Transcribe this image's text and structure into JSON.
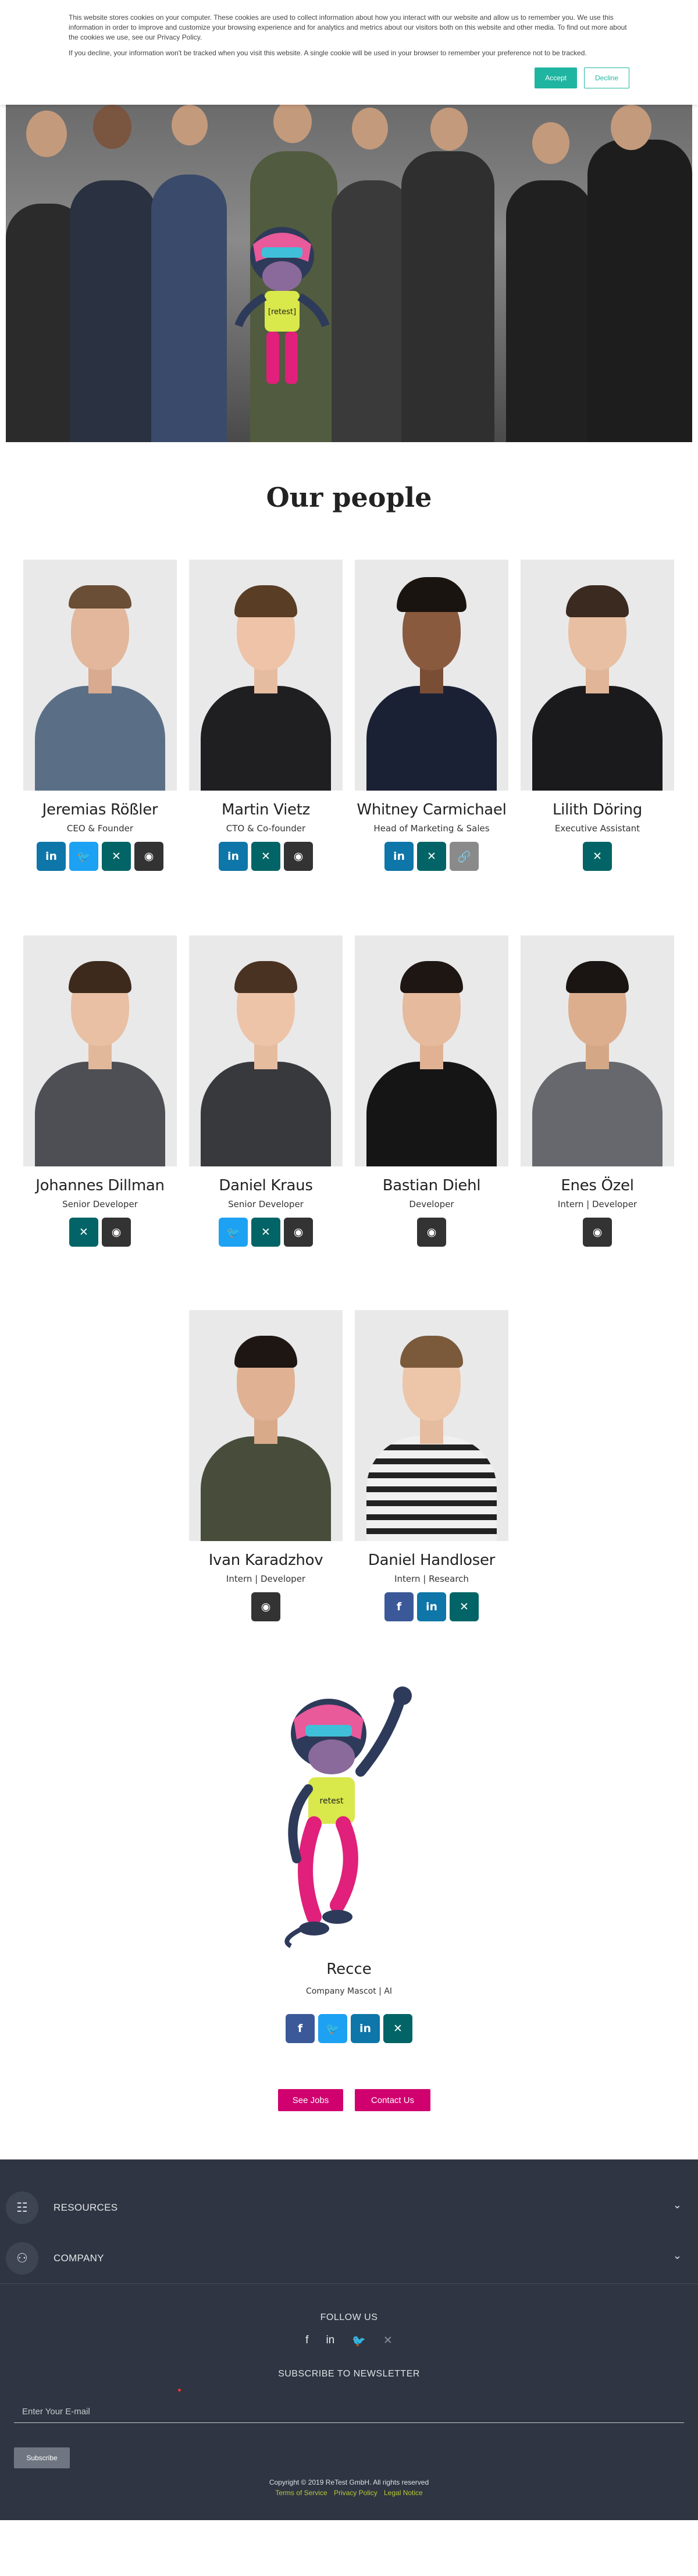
{
  "cookie": {
    "text1": "This website stores cookies on your computer. These cookies are used to collect information about how you interact with our website and allow us to remember you. We use this information in order to improve and customize your browsing experience and for analytics and metrics about our visitors both on this website and other media. To find out more about the cookies we use, see our Privacy Policy.",
    "text2": "If you decline, your information won't be tracked when you visit this website. A single cookie will be used in your browser to remember your preference not to be tracked.",
    "accept": "Accept",
    "decline": "Decline"
  },
  "hero": {
    "mascot_shirt": "[retest]"
  },
  "section_title": "Our people",
  "people": [
    {
      "name": "Jeremias Rößler",
      "role": "CEO & Founder"
    },
    {
      "name": "Martin Vietz",
      "role": "CTO & Co-founder"
    },
    {
      "name": "Whitney Carmichael",
      "role": "Head of Marketing & Sales"
    },
    {
      "name": "Lilith Döring",
      "role": "Executive Assistant"
    },
    {
      "name": "Johannes Dillman",
      "role": "Senior Developer"
    },
    {
      "name": "Daniel Kraus",
      "role": "Senior Developer"
    },
    {
      "name": "Bastian Diehl",
      "role": "Developer"
    },
    {
      "name": "Enes Özel",
      "role": "Intern | Developer"
    },
    {
      "name": "Ivan Karadzhov",
      "role": "Intern | Developer"
    },
    {
      "name": "Daniel Handloser",
      "role": "Intern | Research"
    }
  ],
  "icons": {
    "linkedin": "in",
    "twitter": "🐦",
    "xing": "✕",
    "github": "◉",
    "facebook": "f",
    "link": "🔗"
  },
  "mascot": {
    "name": "Recce",
    "role": "Company Mascot | AI",
    "shirt": "retest"
  },
  "cta": {
    "jobs": "See Jobs",
    "contact": "Contact Us"
  },
  "footer": {
    "resources": "RESOURCES",
    "company": "COMPANY",
    "follow": "FOLLOW US",
    "newsletter": "SUBSCRIBE TO NEWSLETTER",
    "email_placeholder": "Enter Your E-mail",
    "subscribe": "Subscribe",
    "copyright": "Copyright © 2019 ReTest GmbH. All rights reserved",
    "terms": "Terms of Service",
    "privacy": "Privacy Policy",
    "legal": "Legal Notice"
  },
  "colors": {
    "accent": "#1fb5a1",
    "cta": "#d0006f",
    "footer_bg": "#2f3542",
    "linkedin": "#0e76a8",
    "twitter": "#1da1f2",
    "xing": "#026466",
    "github": "#333333",
    "facebook": "#3b5998"
  }
}
